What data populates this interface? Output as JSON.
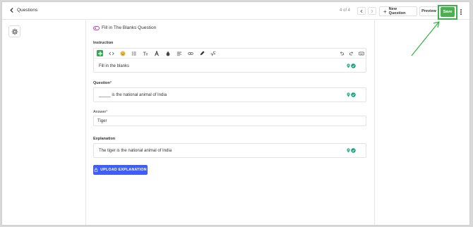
{
  "header": {
    "back_label": "Questions",
    "pager": "4 of 4",
    "new_question_label": "New Question",
    "preview_label": "Preview",
    "save_label": "Save"
  },
  "question_type": "Fill in The Blanks Question",
  "instruction": {
    "label": "Instruction",
    "text": "Fill in the blanks"
  },
  "question": {
    "label": "Question",
    "required_mark": "*",
    "text": "_____ is the national animal of India"
  },
  "answer": {
    "label": "Answer",
    "required_mark": "*",
    "value": "Tiger"
  },
  "explanation": {
    "label": "Explanation",
    "text": "The tiger is the national animal of India"
  },
  "upload_label": "UPLOAD EXPLANATION",
  "colors": {
    "save_green": "#4caf50",
    "highlight_green": "#3cb34a",
    "upload_blue": "#3f5ef7",
    "type_magenta": "#c33cc0"
  }
}
